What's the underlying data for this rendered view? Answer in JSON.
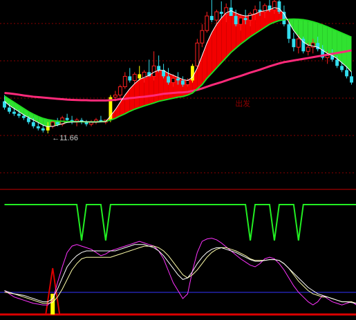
{
  "colors": {
    "background": "#000000",
    "grid": "#8b0000",
    "separator": "#c80000",
    "up_candle": "#ff2020",
    "down_candle": "#33ddee",
    "signal_candle": "#ffff00",
    "ma_long": "#ff2a7a",
    "ma_mid": "#22dd22",
    "ma_short": "#ffffff",
    "ma_short2": "#ffff80",
    "band_up_fill": "#ff0000",
    "band_down_fill": "#33ee33",
    "trigger_line": "#22ee22",
    "k_line": "#ff33ff",
    "d_line": "#ffffaa",
    "j_line": "#ffffff",
    "base_line": "#3333ff",
    "spike_fill": "#dd0000",
    "annotation_text": "#cccccc",
    "faint_label": "#8b0000"
  },
  "chart_data": [
    {
      "panel": "price",
      "type": "candlestick",
      "ylim": [
        9.5,
        18.0
      ],
      "annotations": [
        {
          "text": "←11.66",
          "x": 9,
          "y": 11.66
        },
        {
          "text": "出发",
          "x": 47,
          "y": 13.3
        }
      ],
      "candles": [
        [
          13.2,
          13.5,
          12.8,
          12.9
        ],
        [
          12.9,
          13.1,
          12.6,
          12.7
        ],
        [
          12.7,
          12.9,
          12.5,
          12.6
        ],
        [
          12.6,
          12.8,
          12.4,
          12.5
        ],
        [
          12.5,
          12.6,
          12.3,
          12.4
        ],
        [
          12.4,
          12.5,
          12.1,
          12.2
        ],
        [
          12.2,
          12.4,
          11.9,
          12.0
        ],
        [
          12.0,
          12.2,
          11.8,
          11.9
        ],
        [
          11.9,
          12.1,
          11.7,
          11.8
        ],
        [
          11.8,
          12.2,
          11.66,
          12.0
        ],
        [
          12.0,
          12.3,
          11.9,
          12.2
        ],
        [
          12.2,
          12.4,
          12.0,
          12.1
        ],
        [
          12.1,
          12.5,
          12.0,
          12.4
        ],
        [
          12.4,
          12.6,
          12.2,
          12.3
        ],
        [
          12.3,
          12.5,
          12.1,
          12.2
        ],
        [
          12.2,
          12.4,
          12.0,
          12.3
        ],
        [
          12.3,
          12.4,
          12.1,
          12.2
        ],
        [
          12.2,
          12.3,
          12.0,
          12.1
        ],
        [
          12.1,
          12.3,
          12.0,
          12.2
        ],
        [
          12.2,
          12.4,
          12.1,
          12.3
        ],
        [
          12.3,
          12.5,
          12.2,
          12.2
        ],
        [
          12.2,
          12.3,
          12.1,
          12.3
        ],
        [
          12.3,
          13.5,
          12.2,
          13.4
        ],
        [
          13.4,
          13.7,
          13.2,
          13.5
        ],
        [
          13.5,
          14.0,
          13.3,
          13.9
        ],
        [
          13.9,
          14.6,
          13.8,
          14.4
        ],
        [
          14.4,
          14.8,
          14.1,
          14.2
        ],
        [
          14.2,
          14.6,
          14.0,
          14.5
        ],
        [
          14.5,
          14.9,
          14.2,
          14.3
        ],
        [
          14.3,
          14.7,
          14.1,
          14.6
        ],
        [
          14.6,
          15.2,
          14.5,
          14.4
        ],
        [
          14.4,
          15.6,
          14.2,
          14.9
        ],
        [
          14.9,
          15.4,
          14.6,
          14.7
        ],
        [
          14.7,
          15.0,
          14.3,
          14.4
        ],
        [
          14.4,
          14.8,
          14.0,
          14.1
        ],
        [
          14.1,
          14.5,
          13.9,
          14.3
        ],
        [
          14.3,
          14.6,
          14.0,
          14.2
        ],
        [
          14.2,
          14.4,
          13.9,
          14.0
        ],
        [
          14.0,
          14.3,
          13.9,
          14.2
        ],
        [
          14.2,
          15.0,
          14.1,
          14.9
        ],
        [
          14.9,
          16.2,
          14.8,
          16.0
        ],
        [
          16.0,
          16.9,
          15.8,
          16.6
        ],
        [
          16.6,
          17.5,
          16.5,
          17.3
        ],
        [
          17.3,
          18.3,
          17.0,
          17.1
        ],
        [
          17.1,
          17.6,
          16.8,
          17.5
        ],
        [
          17.5,
          18.0,
          17.2,
          17.4
        ],
        [
          17.4,
          17.9,
          17.0,
          17.7
        ],
        [
          17.7,
          18.1,
          17.3,
          17.3
        ],
        [
          17.3,
          17.6,
          16.8,
          16.9
        ],
        [
          16.9,
          17.4,
          16.6,
          17.2
        ],
        [
          17.2,
          17.6,
          16.9,
          17.1
        ],
        [
          17.1,
          17.5,
          16.8,
          17.4
        ],
        [
          17.4,
          17.8,
          17.1,
          17.6
        ],
        [
          17.6,
          18.0,
          17.3,
          17.5
        ],
        [
          17.5,
          17.9,
          17.2,
          17.8
        ],
        [
          17.8,
          18.2,
          17.5,
          17.6
        ],
        [
          17.6,
          18.4,
          17.4,
          18.0
        ],
        [
          18.0,
          18.3,
          17.4,
          17.5
        ],
        [
          17.5,
          17.8,
          16.8,
          16.9
        ],
        [
          16.9,
          17.0,
          16.0,
          16.2
        ],
        [
          16.2,
          16.5,
          15.6,
          15.8
        ],
        [
          15.8,
          16.4,
          15.5,
          16.2
        ],
        [
          16.2,
          16.3,
          15.5,
          15.6
        ],
        [
          15.6,
          16.0,
          15.4,
          15.8
        ],
        [
          15.8,
          16.2,
          15.5,
          16.0
        ],
        [
          16.0,
          16.3,
          15.6,
          15.7
        ],
        [
          15.7,
          15.9,
          15.2,
          15.3
        ],
        [
          15.3,
          15.6,
          15.0,
          15.4
        ],
        [
          15.4,
          15.7,
          15.1,
          15.2
        ],
        [
          15.2,
          15.4,
          14.8,
          14.9
        ],
        [
          14.9,
          15.1,
          14.6,
          14.7
        ],
        [
          14.7,
          14.9,
          14.3,
          14.4
        ],
        [
          14.4,
          14.6,
          14.0,
          14.1
        ]
      ],
      "signal_bars": [
        9,
        22,
        28,
        39
      ],
      "ma_long": [
        13.6,
        13.58,
        13.55,
        13.52,
        13.48,
        13.45,
        13.42,
        13.4,
        13.38,
        13.36,
        13.34,
        13.32,
        13.3,
        13.28,
        13.27,
        13.26,
        13.25,
        13.25,
        13.24,
        13.24,
        13.24,
        13.24,
        13.25,
        13.27,
        13.3,
        13.32,
        13.35,
        13.37,
        13.4,
        13.42,
        13.45,
        13.48,
        13.52,
        13.56,
        13.58,
        13.6,
        13.62,
        13.63,
        13.65,
        13.7,
        13.75,
        13.82,
        13.9,
        13.98,
        14.05,
        14.12,
        14.2,
        14.28,
        14.35,
        14.42,
        14.5,
        14.58,
        14.65,
        14.72,
        14.8,
        14.88,
        14.95,
        15.02,
        15.08,
        15.12,
        15.16,
        15.2,
        15.24,
        15.28,
        15.32,
        15.36,
        15.4,
        15.44,
        15.48,
        15.52,
        15.56,
        15.6,
        15.65
      ],
      "ma_mid": [
        13.45,
        13.3,
        13.15,
        13.0,
        12.85,
        12.7,
        12.58,
        12.47,
        12.38,
        12.32,
        12.28,
        12.25,
        12.24,
        12.23,
        12.22,
        12.22,
        12.22,
        12.21,
        12.21,
        12.21,
        12.22,
        12.24,
        12.3,
        12.38,
        12.5,
        12.6,
        12.72,
        12.82,
        12.9,
        12.98,
        13.05,
        13.12,
        13.2,
        13.25,
        13.3,
        13.35,
        13.4,
        13.43,
        13.5,
        13.6,
        13.8,
        14.0,
        14.3,
        14.55,
        14.8,
        15.05,
        15.3,
        15.55,
        15.75,
        15.95,
        16.12,
        16.3,
        16.45,
        16.6,
        16.75,
        16.9,
        17.0,
        17.08,
        17.12,
        17.14,
        17.15,
        17.14,
        17.12,
        17.08,
        17.02,
        16.95,
        16.87,
        16.78,
        16.68,
        16.58,
        16.48,
        16.38,
        16.28
      ],
      "ma_short": [
        13.2,
        13.0,
        12.85,
        12.7,
        12.55,
        12.42,
        12.3,
        12.18,
        12.05,
        11.98,
        12.0,
        12.05,
        12.12,
        12.18,
        12.2,
        12.22,
        12.23,
        12.22,
        12.2,
        12.2,
        12.22,
        12.22,
        12.5,
        12.8,
        13.15,
        13.5,
        13.8,
        14.05,
        14.25,
        14.35,
        14.45,
        14.6,
        14.7,
        14.68,
        14.55,
        14.45,
        14.35,
        14.25,
        14.2,
        14.35,
        14.8,
        15.4,
        16.0,
        16.5,
        16.9,
        17.2,
        17.45,
        17.55,
        17.45,
        17.35,
        17.3,
        17.32,
        17.4,
        17.5,
        17.55,
        17.6,
        17.7,
        17.65,
        17.4,
        17.0,
        16.6,
        16.3,
        16.05,
        15.9,
        15.85,
        15.8,
        15.65,
        15.5,
        15.4,
        15.25,
        15.05,
        14.85,
        14.6
      ]
    },
    {
      "panel": "trigger",
      "type": "line",
      "ylim": [
        0,
        1
      ],
      "values": [
        1,
        1,
        1,
        1,
        1,
        1,
        1,
        1,
        1,
        1,
        1,
        1,
        1,
        1,
        1,
        1,
        0,
        1,
        1,
        1,
        1,
        0,
        1,
        1,
        1,
        1,
        1,
        1,
        1,
        1,
        1,
        1,
        1,
        1,
        1,
        1,
        1,
        1,
        1,
        1,
        1,
        1,
        1,
        1,
        1,
        1,
        1,
        1,
        1,
        1,
        1,
        0,
        1,
        1,
        1,
        1,
        0,
        1,
        1,
        1,
        1,
        0,
        1,
        1,
        1,
        1,
        1,
        1,
        1,
        1,
        1,
        1,
        1,
        1
      ]
    },
    {
      "panel": "oscillator",
      "type": "line",
      "ylim": [
        0,
        100
      ],
      "spike_at": 10,
      "signal_bars": [
        10
      ],
      "series": [
        {
          "key": "k",
          "values": [
            30,
            26,
            22,
            20,
            18,
            16,
            14,
            13,
            12,
            12,
            18,
            40,
            60,
            78,
            86,
            88,
            86,
            84,
            82,
            78,
            74,
            76,
            80,
            82,
            84,
            86,
            88,
            90,
            92,
            90,
            88,
            86,
            80,
            70,
            55,
            40,
            30,
            20,
            26,
            55,
            78,
            92,
            95,
            96,
            94,
            90,
            85,
            80,
            75,
            70,
            66,
            62,
            60,
            64,
            70,
            72,
            70,
            64,
            56,
            46,
            36,
            28,
            22,
            16,
            12,
            16,
            24,
            20,
            16,
            14,
            12,
            14,
            16,
            12,
            10
          ]
        },
        {
          "key": "d",
          "values": [
            28,
            27,
            26,
            24,
            22,
            20,
            18,
            16,
            14,
            14,
            15,
            22,
            32,
            44,
            56,
            64,
            70,
            72,
            72,
            72,
            72,
            72,
            72,
            74,
            76,
            78,
            80,
            82,
            84,
            86,
            86,
            86,
            84,
            80,
            74,
            66,
            58,
            50,
            46,
            50,
            56,
            64,
            72,
            78,
            82,
            84,
            84,
            82,
            80,
            77,
            74,
            70,
            68,
            68,
            68,
            69,
            69,
            68,
            64,
            58,
            50,
            42,
            36,
            30,
            26,
            24,
            22,
            22,
            20,
            18,
            16,
            16,
            16,
            14,
            12
          ]
        },
        {
          "key": "j",
          "values": [
            30,
            28,
            26,
            25,
            24,
            22,
            20,
            18,
            16,
            16,
            20,
            32,
            46,
            60,
            68,
            74,
            78,
            80,
            80,
            80,
            80,
            80,
            80,
            80,
            82,
            84,
            86,
            88,
            88,
            88,
            86,
            84,
            80,
            74,
            66,
            58,
            50,
            44,
            46,
            54,
            64,
            72,
            78,
            82,
            84,
            84,
            82,
            80,
            78,
            75,
            72,
            69,
            67,
            67,
            68,
            69,
            69,
            68,
            64,
            58,
            52,
            46,
            40,
            34,
            30,
            26,
            24,
            22,
            20,
            18,
            16,
            16,
            15,
            14,
            12
          ]
        }
      ]
    }
  ]
}
